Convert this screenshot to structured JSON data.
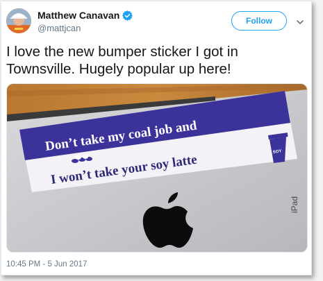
{
  "author": {
    "name": "Matthew Canavan",
    "handle": "@mattjcan",
    "verified": true
  },
  "header": {
    "follow_label": "Follow"
  },
  "tweet": {
    "text": "I love the new bumper sticker I got in Townsville. Hugely popular up here!",
    "timestamp": "10:45 PM - 5 Jun 2017"
  },
  "media": {
    "sticker_line1": "Don’t take my coal job and",
    "sticker_line2": "I won’t take your soy latte",
    "cup_label": "SOY",
    "device_label": "iPad"
  },
  "colors": {
    "twitter_blue": "#1da1f2",
    "sticker_blue": "#3b3399",
    "sticker_white": "#f4f2f7"
  },
  "icons": {
    "verified": "verified-badge-icon",
    "menu": "chevron-down-icon"
  }
}
